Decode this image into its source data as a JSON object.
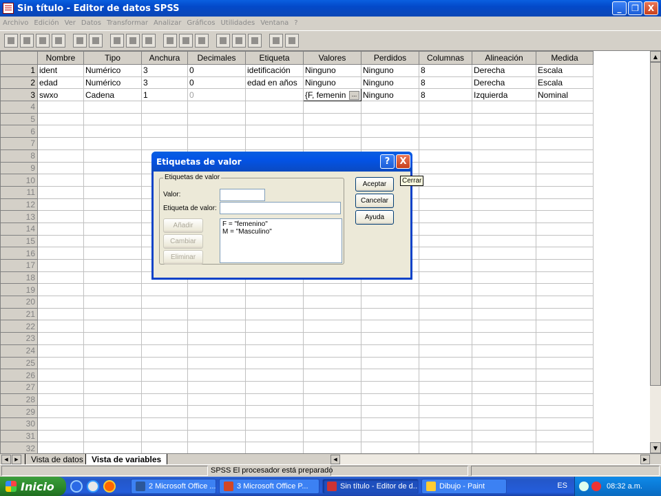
{
  "window": {
    "title": "Sin título - Editor de datos SPSS",
    "controls": [
      "_",
      "❐",
      "X"
    ]
  },
  "menu": [
    "Archivo",
    "Edición",
    "Ver",
    "Datos",
    "Transformar",
    "Analizar",
    "Gráficos",
    "Utilidades",
    "Ventana",
    "?"
  ],
  "grid": {
    "columns": [
      "Nombre",
      "Tipo",
      "Anchura",
      "Decimales",
      "Etiqueta",
      "Valores",
      "Perdidos",
      "Columnas",
      "Alineación",
      "Medida"
    ],
    "rows": [
      [
        "ident",
        "Numérico",
        "3",
        "0",
        "idetificación",
        "Ninguno",
        "Ninguno",
        "8",
        "Derecha",
        "Escala"
      ],
      [
        "edad",
        "Numérico",
        "3",
        "0",
        "edad en años",
        "Ninguno",
        "Ninguno",
        "8",
        "Derecha",
        "Escala"
      ],
      [
        "swxo",
        "Cadena",
        "1",
        "0",
        "",
        "{F, femenin",
        "Ninguno",
        "8",
        "Izquierda",
        "Nominal"
      ]
    ],
    "row_numbers": [
      "1",
      "2",
      "3",
      "4",
      "5",
      "6",
      "7",
      "8",
      "9",
      "10",
      "11",
      "12",
      "13",
      "14",
      "15",
      "16",
      "17",
      "18",
      "19",
      "20",
      "21",
      "22",
      "23",
      "24",
      "25",
      "26",
      "27",
      "28",
      "29",
      "30",
      "31",
      "32"
    ],
    "cell_button": "..."
  },
  "tabs": {
    "data_view": "Vista de datos",
    "variable_view": "Vista de variables"
  },
  "status": "SPSS El procesador  está preparado",
  "dialog": {
    "title": "Etiquetas de valor",
    "help": "?",
    "close": "X",
    "group_label": "Etiquetas de valor",
    "value_label": "Valor:",
    "value_input": "",
    "label_label": "Etiqueta de valor:",
    "label_input": "",
    "add": "Añadir",
    "change": "Cambiar",
    "remove": "Eliminar",
    "list": [
      "F = \"femenino\"",
      "M = \"Masculino\""
    ],
    "ok": "Aceptar",
    "cancel": "Cancelar",
    "help_button": "Ayuda"
  },
  "tooltip": "Cerrar",
  "taskbar": {
    "start": "Inicio",
    "items": [
      "2 Microsoft Office ...",
      "3 Microsoft Office P...",
      "Sin título - Editor de d...",
      "Dibujo - Paint"
    ],
    "active_index": 2,
    "language": "ES",
    "clock": "08:32 a.m."
  }
}
